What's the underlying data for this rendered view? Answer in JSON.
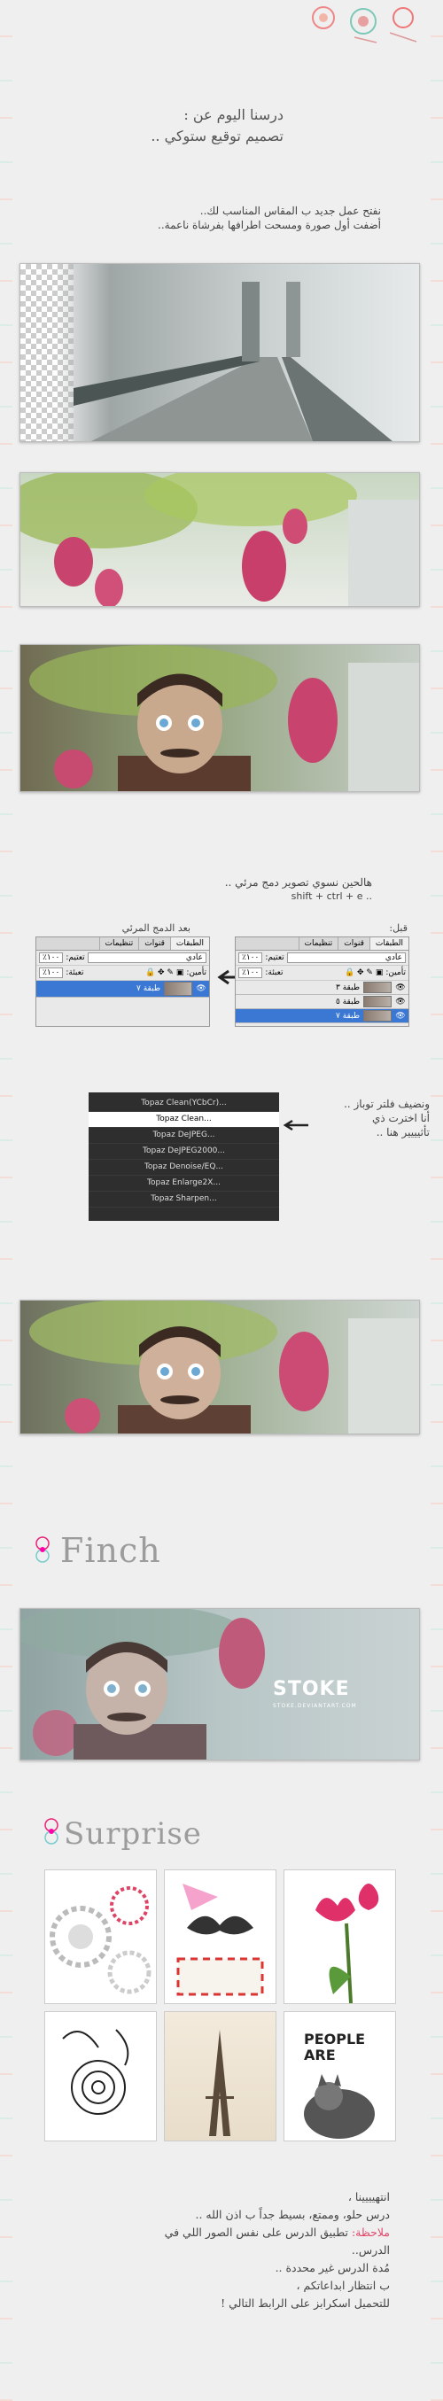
{
  "intro": {
    "title_line1": "درسنا اليوم عن :",
    "title_line2": "تصميم توقيع ستوكي .."
  },
  "step1": {
    "line1": "نفتح عمل جديد ب المقاس المناسب لك..",
    "line2": "أضفت أول صورة ومسحت اطرافها بفرشاة ناعمة.."
  },
  "step2": {
    "line1": "هالحين نسوي تصوير دمج مرئي ..",
    "shortcut": "shift + ctrl + e ..",
    "label_before": "قبل:",
    "label_after": "بعد الدمج المرئي"
  },
  "layers_before": {
    "tabs": [
      "تنظيمات",
      "قنوات",
      "الطبقات"
    ],
    "blend": "عادي",
    "opacity_label": "تعتيم:",
    "opacity": "١٠٠٪",
    "lock_label": "تأمين:",
    "fill_label": "تعبئة:",
    "fill": "١٠٠٪",
    "layers": [
      "طبقة ٣",
      "طبقة ٥",
      "طبقة ٧"
    ]
  },
  "layers_after": {
    "tabs": [
      "تنظيمات",
      "قنوات",
      "الطبقات"
    ],
    "blend": "عادي",
    "opacity_label": "تعتيم:",
    "opacity": "١٠٠٪",
    "lock_label": "تأمين:",
    "fill_label": "تعبئة:",
    "fill": "١٠٠٪",
    "layers": [
      "طبقة ٧"
    ]
  },
  "step3": {
    "line1": "ونضيف فلتر توباز ..",
    "line2": "أنا اخترت ذي",
    "line3": "تأثيييير هنا .."
  },
  "topaz_menu": {
    "items": [
      "Topaz Clean(YCbCr)...",
      "Topaz Clean...",
      "Topaz DeJPEG...",
      "Topaz DeJPEG2000...",
      "Topaz Denoise/EQ...",
      "Topaz Enlarge2X...",
      "Topaz Sharpen..."
    ]
  },
  "finch": {
    "title": "Finch",
    "stoke": "STOKE",
    "stoke_sub": "STOKE.DEVIANTART.COM"
  },
  "surprise": {
    "title": "Surprise",
    "people_text": "PEOPLE ARE"
  },
  "outro": {
    "line1": "انتهيييينا ،",
    "line2": "درس حلو، وممتع، بسيط جداً ب اذن الله ..",
    "note_label": "ملاحظة:",
    "note_text": "تطبيق الدرس على نفس الصور اللي في",
    "line4": "الدرس..",
    "line5": "مُدة الدرس غير محددة ..",
    "line6": "ب انتظار ابداعاتكم ،",
    "line7": "للتحميل اسكرابز على الرابط التالي !"
  },
  "colors": {
    "background": "#efefef",
    "accent_pink": "#e0476a",
    "title_grey": "#9c9c9c",
    "layer_selected": "#3a78d4"
  }
}
